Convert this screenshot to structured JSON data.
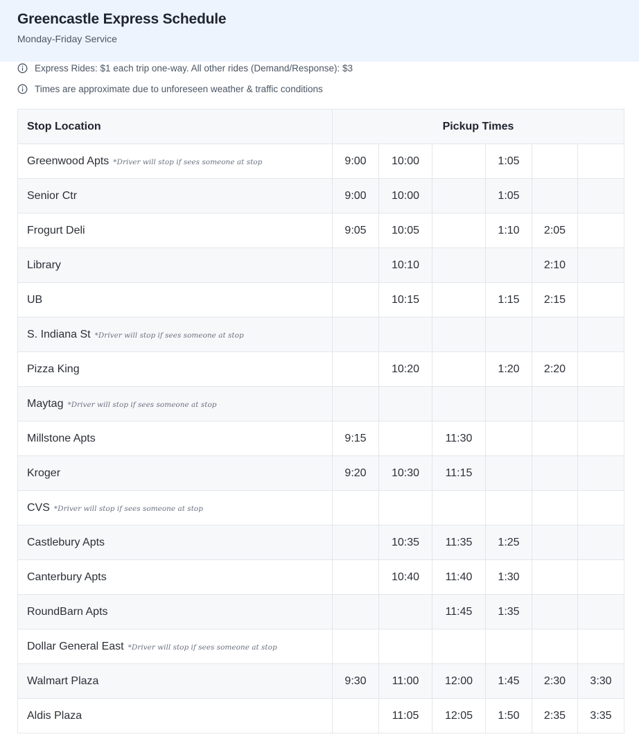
{
  "header": {
    "title": "Greencastle Express Schedule",
    "subtitle": "Monday-Friday Service"
  },
  "notes": [
    {
      "icon": "info-icon",
      "text": "Express Rides: $1 each trip one-way. All other rides (Demand/Response): $3"
    },
    {
      "icon": "info-icon",
      "text": "Times are approximate due to unforeseen weather & traffic conditions"
    }
  ],
  "table": {
    "headers": {
      "stop": "Stop Location",
      "times": "Pickup Times"
    },
    "rows": [
      {
        "stop": "Greenwood Apts",
        "note": "*Driver will stop if sees someone at stop",
        "times": [
          "9:00",
          "10:00",
          "",
          "1:05",
          "",
          ""
        ]
      },
      {
        "stop": "Senior Ctr",
        "note": "",
        "times": [
          "9:00",
          "10:00",
          "",
          "1:05",
          "",
          ""
        ]
      },
      {
        "stop": "Frogurt Deli",
        "note": "",
        "times": [
          "9:05",
          "10:05",
          "",
          "1:10",
          "2:05",
          ""
        ]
      },
      {
        "stop": "Library",
        "note": "",
        "times": [
          "",
          "10:10",
          "",
          "",
          "2:10",
          ""
        ]
      },
      {
        "stop": "UB",
        "note": "",
        "times": [
          "",
          "10:15",
          "",
          "1:15",
          "2:15",
          ""
        ]
      },
      {
        "stop": "S. Indiana St",
        "note": "*Driver will stop if sees someone at stop",
        "times": [
          "",
          "",
          "",
          "",
          "",
          ""
        ]
      },
      {
        "stop": "Pizza King",
        "note": "",
        "times": [
          "",
          "10:20",
          "",
          "1:20",
          "2:20",
          ""
        ]
      },
      {
        "stop": "Maytag",
        "note": "*Driver will stop if sees someone at stop",
        "times": [
          "",
          "",
          "",
          "",
          "",
          ""
        ]
      },
      {
        "stop": "Millstone Apts",
        "note": "",
        "times": [
          "9:15",
          "",
          "11:30",
          "",
          "",
          ""
        ]
      },
      {
        "stop": "Kroger",
        "note": "",
        "times": [
          "9:20",
          "10:30",
          "11:15",
          "",
          "",
          ""
        ]
      },
      {
        "stop": "CVS",
        "note": "*Driver will stop if sees someone at stop",
        "times": [
          "",
          "",
          "",
          "",
          "",
          ""
        ]
      },
      {
        "stop": "Castlebury Apts",
        "note": "",
        "times": [
          "",
          "10:35",
          "11:35",
          "1:25",
          "",
          ""
        ]
      },
      {
        "stop": "Canterbury Apts",
        "note": "",
        "times": [
          "",
          "10:40",
          "11:40",
          "1:30",
          "",
          ""
        ]
      },
      {
        "stop": "RoundBarn Apts",
        "note": "",
        "times": [
          "",
          "",
          "11:45",
          "1:35",
          "",
          ""
        ]
      },
      {
        "stop": "Dollar General East",
        "note": "*Driver will stop if sees someone at stop",
        "times": [
          "",
          "",
          "",
          "",
          "",
          ""
        ]
      },
      {
        "stop": "Walmart Plaza",
        "note": "",
        "times": [
          "9:30",
          "11:00",
          "12:00",
          "1:45",
          "2:30",
          "3:30"
        ]
      },
      {
        "stop": "Aldis Plaza",
        "note": "",
        "times": [
          "",
          "11:05",
          "12:05",
          "1:50",
          "2:35",
          "3:35"
        ]
      }
    ]
  }
}
